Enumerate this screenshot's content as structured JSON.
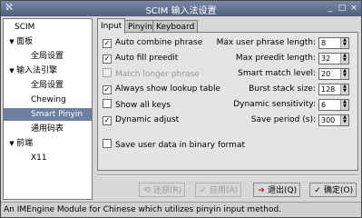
{
  "window": {
    "title": "SCIM 输入法设置",
    "app_icon": "ℵ",
    "minimize_glyph": "_",
    "maximize_glyph": "□",
    "close_glyph": "×"
  },
  "sidebar": {
    "items": [
      {
        "label": "SCIM",
        "arrow": ""
      },
      {
        "label": "面板",
        "arrow": "▼"
      },
      {
        "label": "全局设置",
        "arrow": ""
      },
      {
        "label": "输入法引擎",
        "arrow": "▼"
      },
      {
        "label": "全局设置",
        "arrow": ""
      },
      {
        "label": "Chewing",
        "arrow": ""
      },
      {
        "label": "Smart Pinyin",
        "arrow": ""
      },
      {
        "label": "通用码表",
        "arrow": ""
      },
      {
        "label": "前端",
        "arrow": "▼"
      },
      {
        "label": "X11",
        "arrow": ""
      }
    ],
    "selected_index": 6
  },
  "tabs": [
    "Input",
    "Pinyin",
    "Keyboard"
  ],
  "options": [
    {
      "label": "Auto combine phrase",
      "checked": true,
      "enabled": true
    },
    {
      "label": "Auto fill preedit",
      "checked": true,
      "enabled": true
    },
    {
      "label": "Match longer phrase",
      "checked": false,
      "enabled": false
    },
    {
      "label": "Always show lookup table",
      "checked": true,
      "enabled": true
    },
    {
      "label": "Show all keys",
      "checked": false,
      "enabled": true
    },
    {
      "label": "Dynamic adjust",
      "checked": true,
      "enabled": true
    }
  ],
  "save_binary": {
    "label": "Save user data in binary format",
    "checked": false
  },
  "fields": [
    {
      "label": "Max user phrase length:",
      "value": "8"
    },
    {
      "label": "Max preedit length:",
      "value": "32"
    },
    {
      "label": "Smart match level:",
      "value": "20"
    },
    {
      "label": "Burst stack size:",
      "value": "128"
    },
    {
      "label": "Dynamic sensitivity:",
      "value": "6"
    },
    {
      "label": "Save period (s):",
      "value": "300"
    }
  ],
  "buttons": {
    "revert": "还原(R)",
    "apply": "应用(A)",
    "exit": "退出(Q)",
    "ok": "确定(O)"
  },
  "status": "An IMEngine Module for Chinese which utilizes pinyin input method."
}
